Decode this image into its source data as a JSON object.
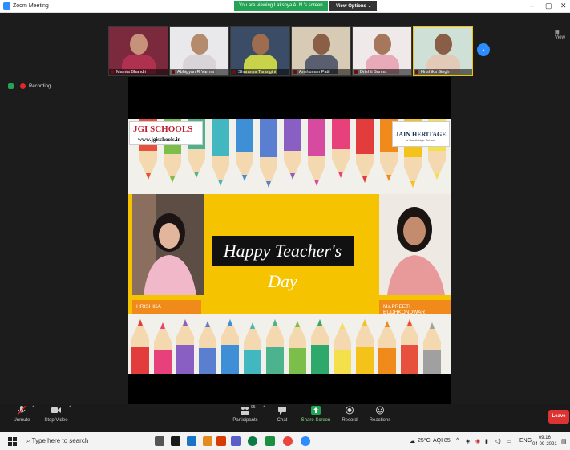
{
  "window": {
    "title": "Zoom Meeting"
  },
  "banner": {
    "viewing_text": "You are viewing Lakshya A. N.'s screen",
    "view_options_label": "View Options"
  },
  "participants": [
    {
      "name": "Mamta Bhandri"
    },
    {
      "name": "Abhigyan R Varma"
    },
    {
      "name": "Sharanya Tarangini"
    },
    {
      "name": "Anshuman Patil"
    },
    {
      "name": "Drishti Sarma"
    },
    {
      "name": "Hrishika Singh"
    }
  ],
  "view_tag": "View",
  "recording_label": "Recording",
  "slide": {
    "logo_left": {
      "brand": "JGI SCHOOLS",
      "url": "www.jgischools.in"
    },
    "logo_right": {
      "brand": "JAIN HERITAGE",
      "sub": "a Cambridge School"
    },
    "headline": "Happy Teacher's Day",
    "label_left": "HRISHIKA",
    "label_right": "Ms.PREETI BUDHKONDWAR"
  },
  "toolbar": {
    "unmute": "Unmute",
    "stop_video": "Stop Video",
    "participants": "Participants",
    "participants_count": "95",
    "chat": "Chat",
    "share_screen": "Share Screen",
    "record": "Record",
    "reactions": "Reactions",
    "leave": "Leave"
  },
  "taskbar": {
    "search_placeholder": "Type here to search",
    "weather": "25°C",
    "aqi": "AQI 85",
    "language": "ENG",
    "time": "09:16",
    "date": "04-09-2021"
  },
  "colors": {
    "zoom_blue": "#2d8cff",
    "share_green": "#23a455",
    "leave_red": "#dd3333",
    "banner_yellow": "#f6c300",
    "label_orange": "#f08a1a"
  }
}
